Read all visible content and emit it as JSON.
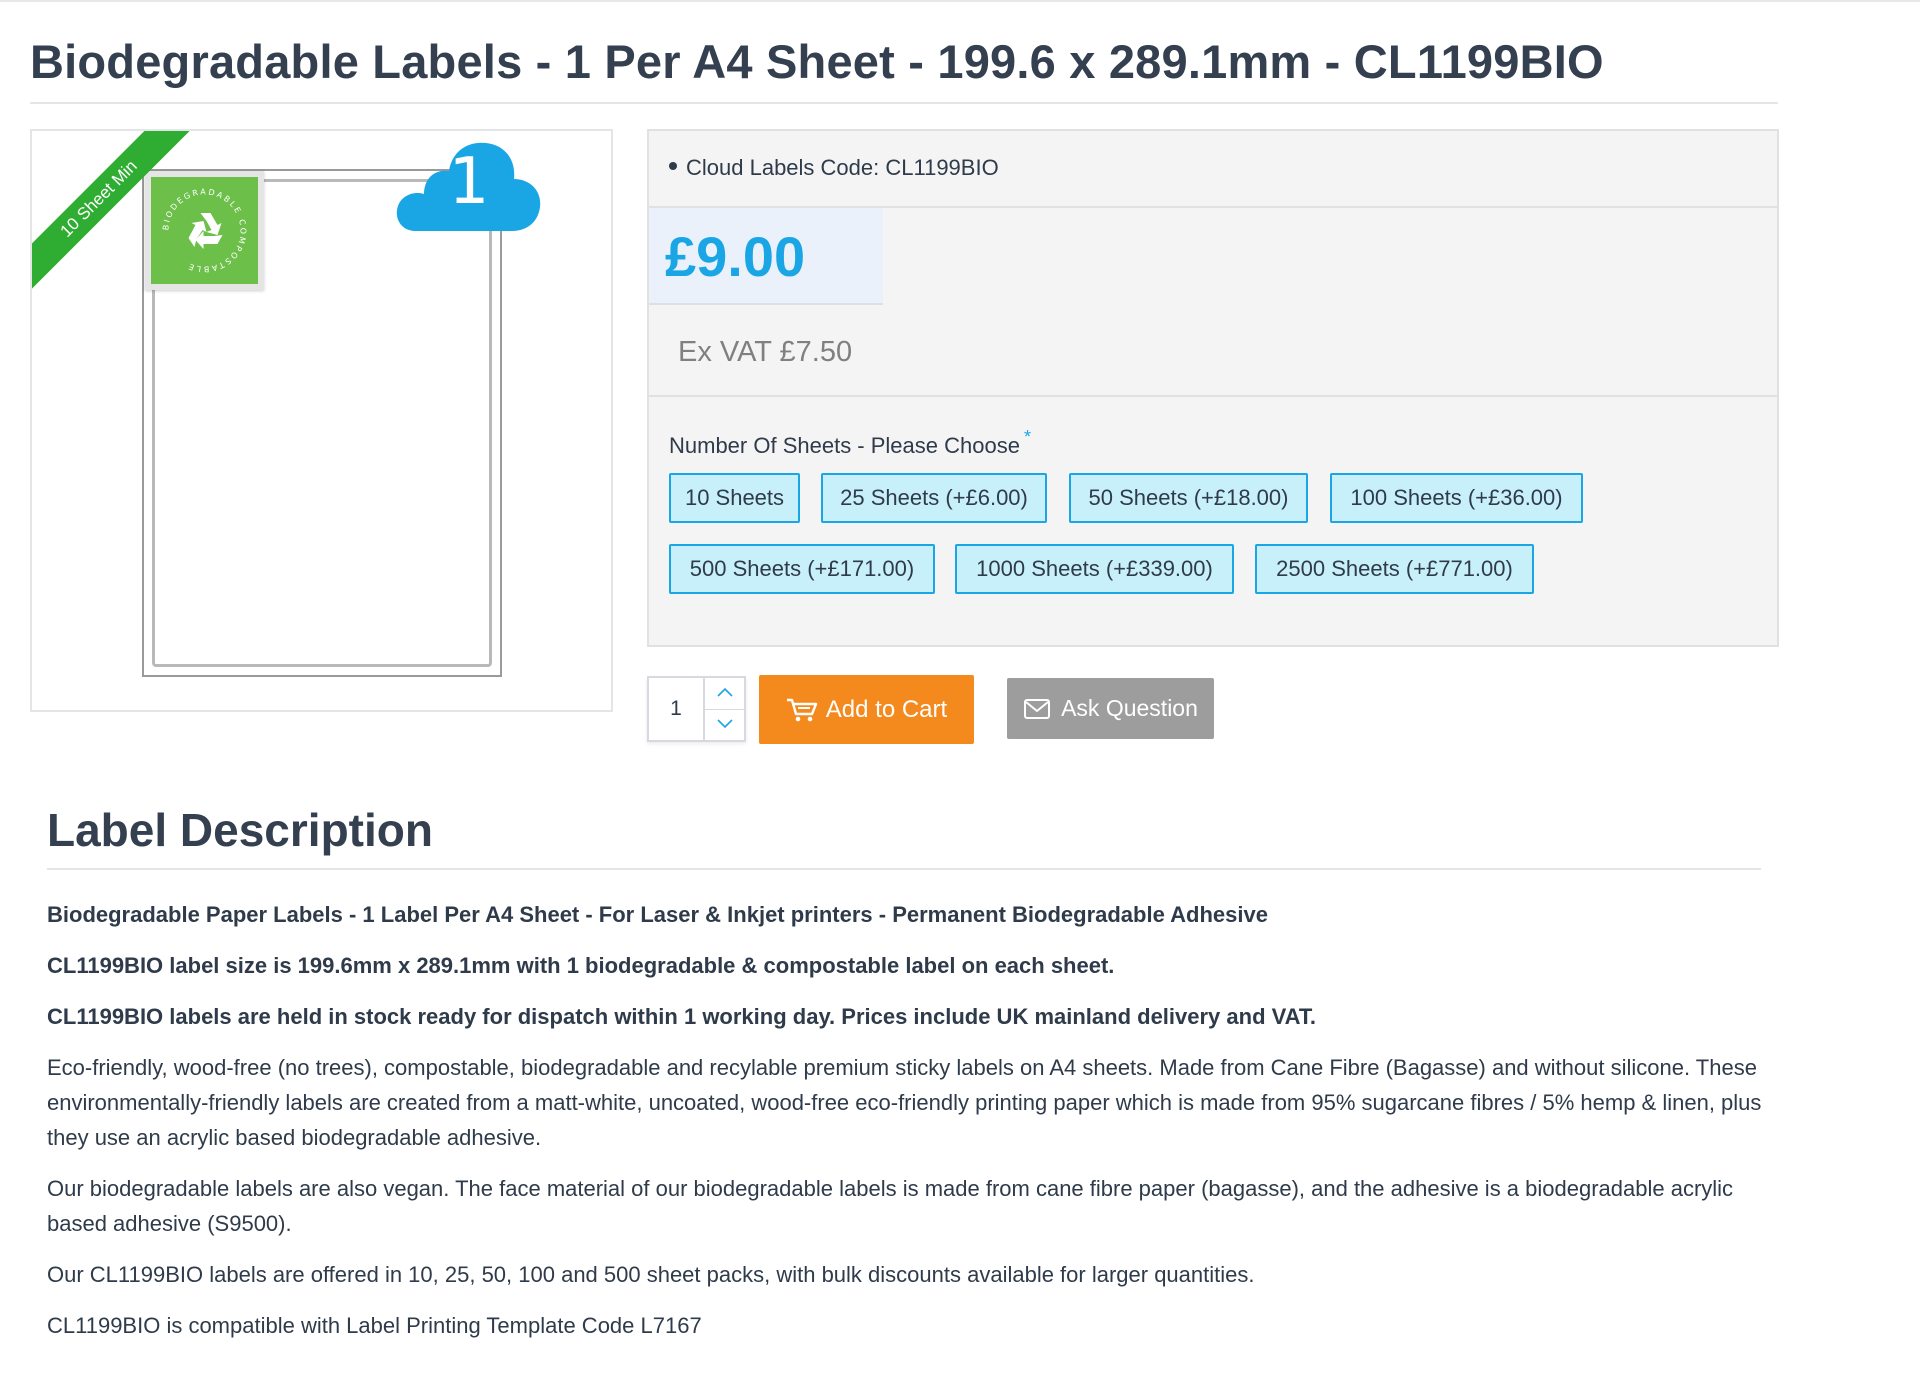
{
  "product": {
    "title": "Biodegradable Labels - 1 Per A4 Sheet - 199.6 x 289.1mm - CL1199BIO",
    "ribbon": "10 Sheet Min",
    "cloud_badge": "1",
    "badge_text": "BIODEGRADABLE COMPOSTABLE",
    "code_label": "Cloud Labels Code: CL1199BIO",
    "price": "£9.00",
    "ex_vat": "Ex VAT £7.50",
    "accent_color": "#1aa6e5"
  },
  "options": {
    "label": "Number Of Sheets - Please Choose",
    "required_marker": "*",
    "choices": [
      "10 Sheets",
      "25 Sheets (+£6.00)",
      "50 Sheets (+£18.00)",
      "100 Sheets (+£36.00)",
      "500 Sheets (+£171.00)",
      "1000 Sheets (+£339.00)",
      "2500 Sheets (+£771.00)"
    ]
  },
  "cart": {
    "quantity": "1",
    "add_label": "Add to Cart",
    "ask_label": "Ask Question",
    "add_color": "#f48a1e",
    "ask_color": "#9d9d9d"
  },
  "description": {
    "heading": "Label Description",
    "bold_lines": [
      "Biodegradable Paper Labels - 1 Label Per A4 Sheet - For Laser & Inkjet printers - Permanent Biodegradable Adhesive",
      "CL1199BIO label size is 199.6mm x 289.1mm with 1 biodegradable & compostable label on each sheet.",
      "CL1199BIO labels are held in stock ready for dispatch within 1 working day. Prices include UK mainland delivery and VAT."
    ],
    "paragraphs": [
      "Eco-friendly, wood-free (no trees), compostable, biodegradable and recylable premium sticky labels on A4 sheets. Made from Cane Fibre (Bagasse) and without silicone. These environmentally-friendly labels are created from a matt-white, uncoated, wood-free eco-friendly printing paper which is made from 95% sugarcane fibres / 5% hemp & linen, plus they use an acrylic based biodegradable adhesive.",
      "Our biodegradable labels are also vegan. The face material of our biodegradable labels is made from cane fibre paper (bagasse), and the adhesive is a biodegradable acrylic based adhesive (S9500).",
      "Our CL1199BIO labels are offered in 10, 25, 50, 100 and 500 sheet packs, with bulk discounts available for larger quantities.",
      "CL1199BIO is compatible with Label Printing Template Code L7167"
    ]
  }
}
